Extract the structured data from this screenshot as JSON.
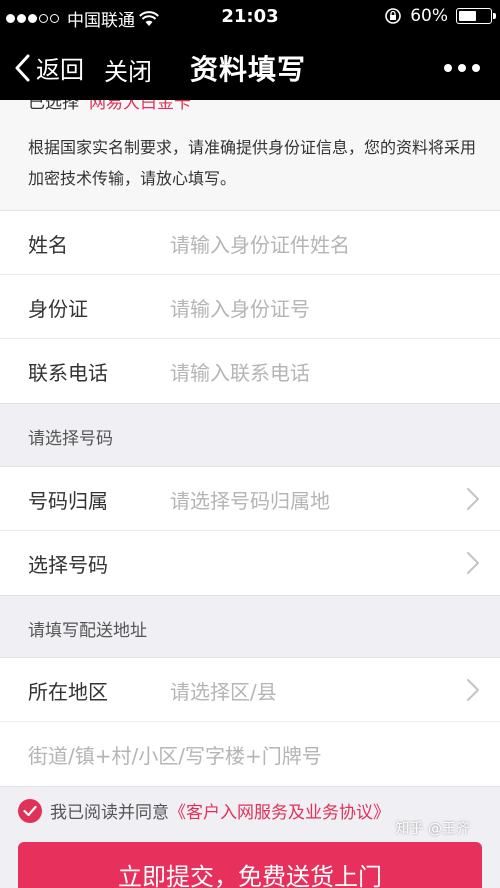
{
  "status": {
    "carrier": "中国联通",
    "time": "21:03",
    "battery": "60%",
    "battery_level": 0.6
  },
  "nav": {
    "back": "返回",
    "close": "关闭",
    "title": "资料填写"
  },
  "notice": {
    "selected_label": "已选择",
    "selected_value": "网易大白金卡",
    "description": "根据国家实名制要求，请准确提供身份证信息，您的资料将采用加密技术传输，请放心填写。"
  },
  "identity": {
    "name_label": "姓名",
    "name_placeholder": "请输入身份证件姓名",
    "id_label": "身份证",
    "id_placeholder": "请输入身份证号",
    "phone_label": "联系电话",
    "phone_placeholder": "请输入联系电话"
  },
  "number_section": {
    "title": "请选择号码",
    "region_label": "号码归属",
    "region_placeholder": "请选择号码归属地",
    "select_label": "选择号码"
  },
  "address_section": {
    "title": "请填写配送地址",
    "area_label": "所在地区",
    "area_placeholder": "请选择区/县",
    "street_placeholder": "街道/镇+村/小区/写字楼+门牌号"
  },
  "agreement": {
    "prefix": "我已阅读并同意",
    "link": "《客户入网服务及业务协议》"
  },
  "submit": "立即提交，免费送货上门",
  "watermark": "知乎 @王齐",
  "colors": {
    "accent": "#e0315a",
    "placeholder": "#b5b5b5"
  }
}
